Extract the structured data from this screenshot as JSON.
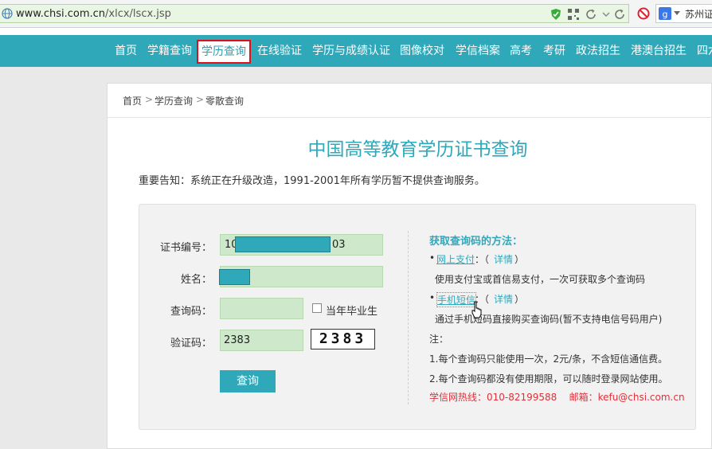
{
  "browser": {
    "url_host": "www.chsi.com.cn",
    "url_path": "/xlcx/lscx.jsp",
    "search_text": "苏州证"
  },
  "nav": {
    "items": [
      "首页",
      "学籍查询",
      "学历查询",
      "在线验证",
      "学历与成绩认证",
      "图像校对",
      "学信档案",
      "高考",
      "考研",
      "政法招生",
      "港澳台招生",
      "四六"
    ]
  },
  "breadcrumb": {
    "home": "首页",
    "sep": ">",
    "level2": "学历查询",
    "current": "零散查询"
  },
  "page": {
    "title": "中国高等教育学历证书查询",
    "notice": "重要告知：系统正在升级改造，1991-2001年所有学历暂不提供查询服务。"
  },
  "form": {
    "cert_label": "证书编号：",
    "cert_prefix": "10",
    "cert_suffix": "03",
    "name_label": "姓名：",
    "query_code_label": "查询码：",
    "graduate_label": "当年毕业生",
    "verify_label": "验证码：",
    "verify_value": "2383",
    "captcha_text": "2383",
    "submit_label": "查询"
  },
  "help": {
    "heading": "获取查询码的方法：",
    "bullet": "•",
    "online_pay": "网上支付",
    "colon_paren": "：（",
    "details": "详情",
    "close_paren": "）",
    "online_desc": "使用支付宝或首信易支付，一次可获取多个查询码",
    "sms": "手机短信",
    "sms_desc": "通过手机短码直接购买查询码(暂不支持电信号码用户)",
    "note_label": "注：",
    "note1": "1.每个查询码只能使用一次，2元/条，不含短信通信费。",
    "note2": "2.每个查询码都没有使用期限，可以随时登录网站使用。",
    "hotline": "学信网热线：010-82199588    邮箱：kefu@chsi.com.cn"
  }
}
